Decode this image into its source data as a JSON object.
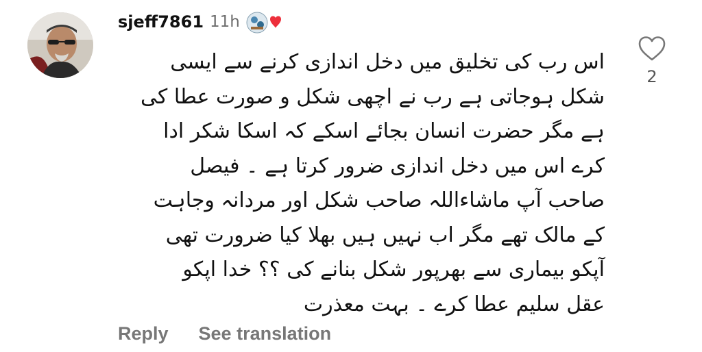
{
  "comment": {
    "username": "sjeff7861",
    "time_ago": "11h",
    "avatar_icon": "profile-avatar",
    "badge_icon": "art-badge-with-heart",
    "text": "اس رب کی تخلیق میں دخل اندازی کرنے سے ایسی\nشکل ہوجاتی ہے  رب نے اچھی شکل و صورت عطا کی\nہے مگر حضرت انسان بجائے اسکے کہ اسکا شکر ادا\nکرے  اس میں دخل اندازی ضرور کرتا ہے ۔ فیصل\nصاحب آپ ماشاءاللہ صاحب شکل اور مردانہ وجاہت\nکے مالک تھے مگر اب نہیں ہیں  بھلا کیا ضرورت تھی\nآپکو بیماری سے بھرپور شکل بنانے کی ؟؟ خدا اپکو\nعقل سلیم عطا کرے ۔ بہت معذرت",
    "like_icon": "heart-outline-icon",
    "like_count": "2",
    "reply_label": "Reply",
    "see_translation_label": "See translation"
  },
  "colors": {
    "text": "#111111",
    "muted": "#6e6e6e",
    "action": "#777777",
    "heart_badge": "#ed2f3b"
  }
}
